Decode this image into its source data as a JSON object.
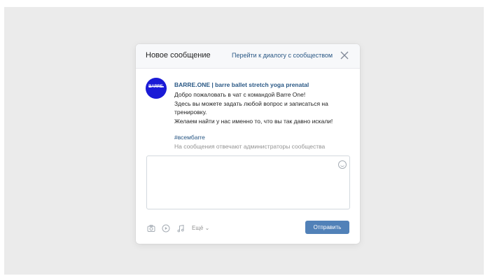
{
  "modal": {
    "title": "Новое сообщение",
    "goto_dialog_link": "Перейти к диалогу с сообществом",
    "close_icon": "close-icon"
  },
  "community": {
    "avatar_text": "BARRE.",
    "name": "BARRE.ONE | barre ballet stretch yoga prenatal",
    "greeting_lines": [
      "Добро пожаловать в чат с командой Barre One!",
      "Здесь вы можете задать любой вопрос и записаться на",
      "тренировку.",
      "Желаем найти у нас именно то, что вы так давно искали!"
    ],
    "hashtag": "#всембarre",
    "admin_note": "На сообщения отвечают администраторы сообщества"
  },
  "composer": {
    "emoji_icon": "smile-icon",
    "attach_icons": [
      "camera-icon",
      "video-icon",
      "music-icon"
    ],
    "more_label": "Ещё",
    "send_label": "Отправить"
  },
  "colors": {
    "link": "#2a5885",
    "send_button": "#5181b8",
    "avatar_bg": "#1a1ad6",
    "backdrop": "#ebebeb"
  }
}
